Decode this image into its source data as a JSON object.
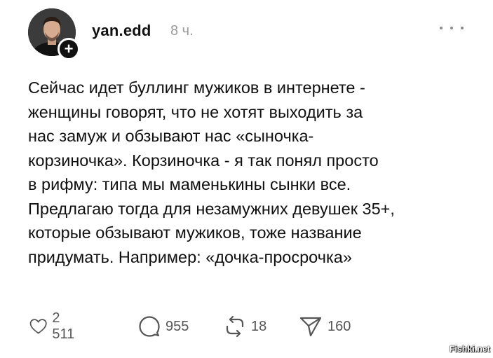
{
  "post": {
    "author": {
      "username": "yan.edd",
      "avatar_icon": "person-photo",
      "follow_icon": "plus-icon",
      "follow_glyph": "+"
    },
    "timestamp": "8 ч.",
    "more_icon": "ellipsis-icon",
    "text_lines": [
      "Сейчас идет буллинг мужиков в интернете -",
      "женщины говорят, что не хотят выходить за",
      "нас замуж и обзывают нас «сыночка-",
      "корзиночка». Корзиночка - я так понял просто",
      "в рифму: типа мы маменькины сынки все.",
      "Предлагаю тогда для незамужних девушек 35+,",
      "которые обзывают мужиков, тоже название",
      "придумать. Например: «дочка-просрочка»"
    ],
    "actions": {
      "likes": {
        "icon": "heart-icon",
        "count": "2 511"
      },
      "comments": {
        "icon": "comment-icon",
        "count": "955"
      },
      "reposts": {
        "icon": "repost-icon",
        "count": "18"
      },
      "shares": {
        "icon": "send-icon",
        "count": "160"
      }
    }
  },
  "watermark": "Fishki.net"
}
